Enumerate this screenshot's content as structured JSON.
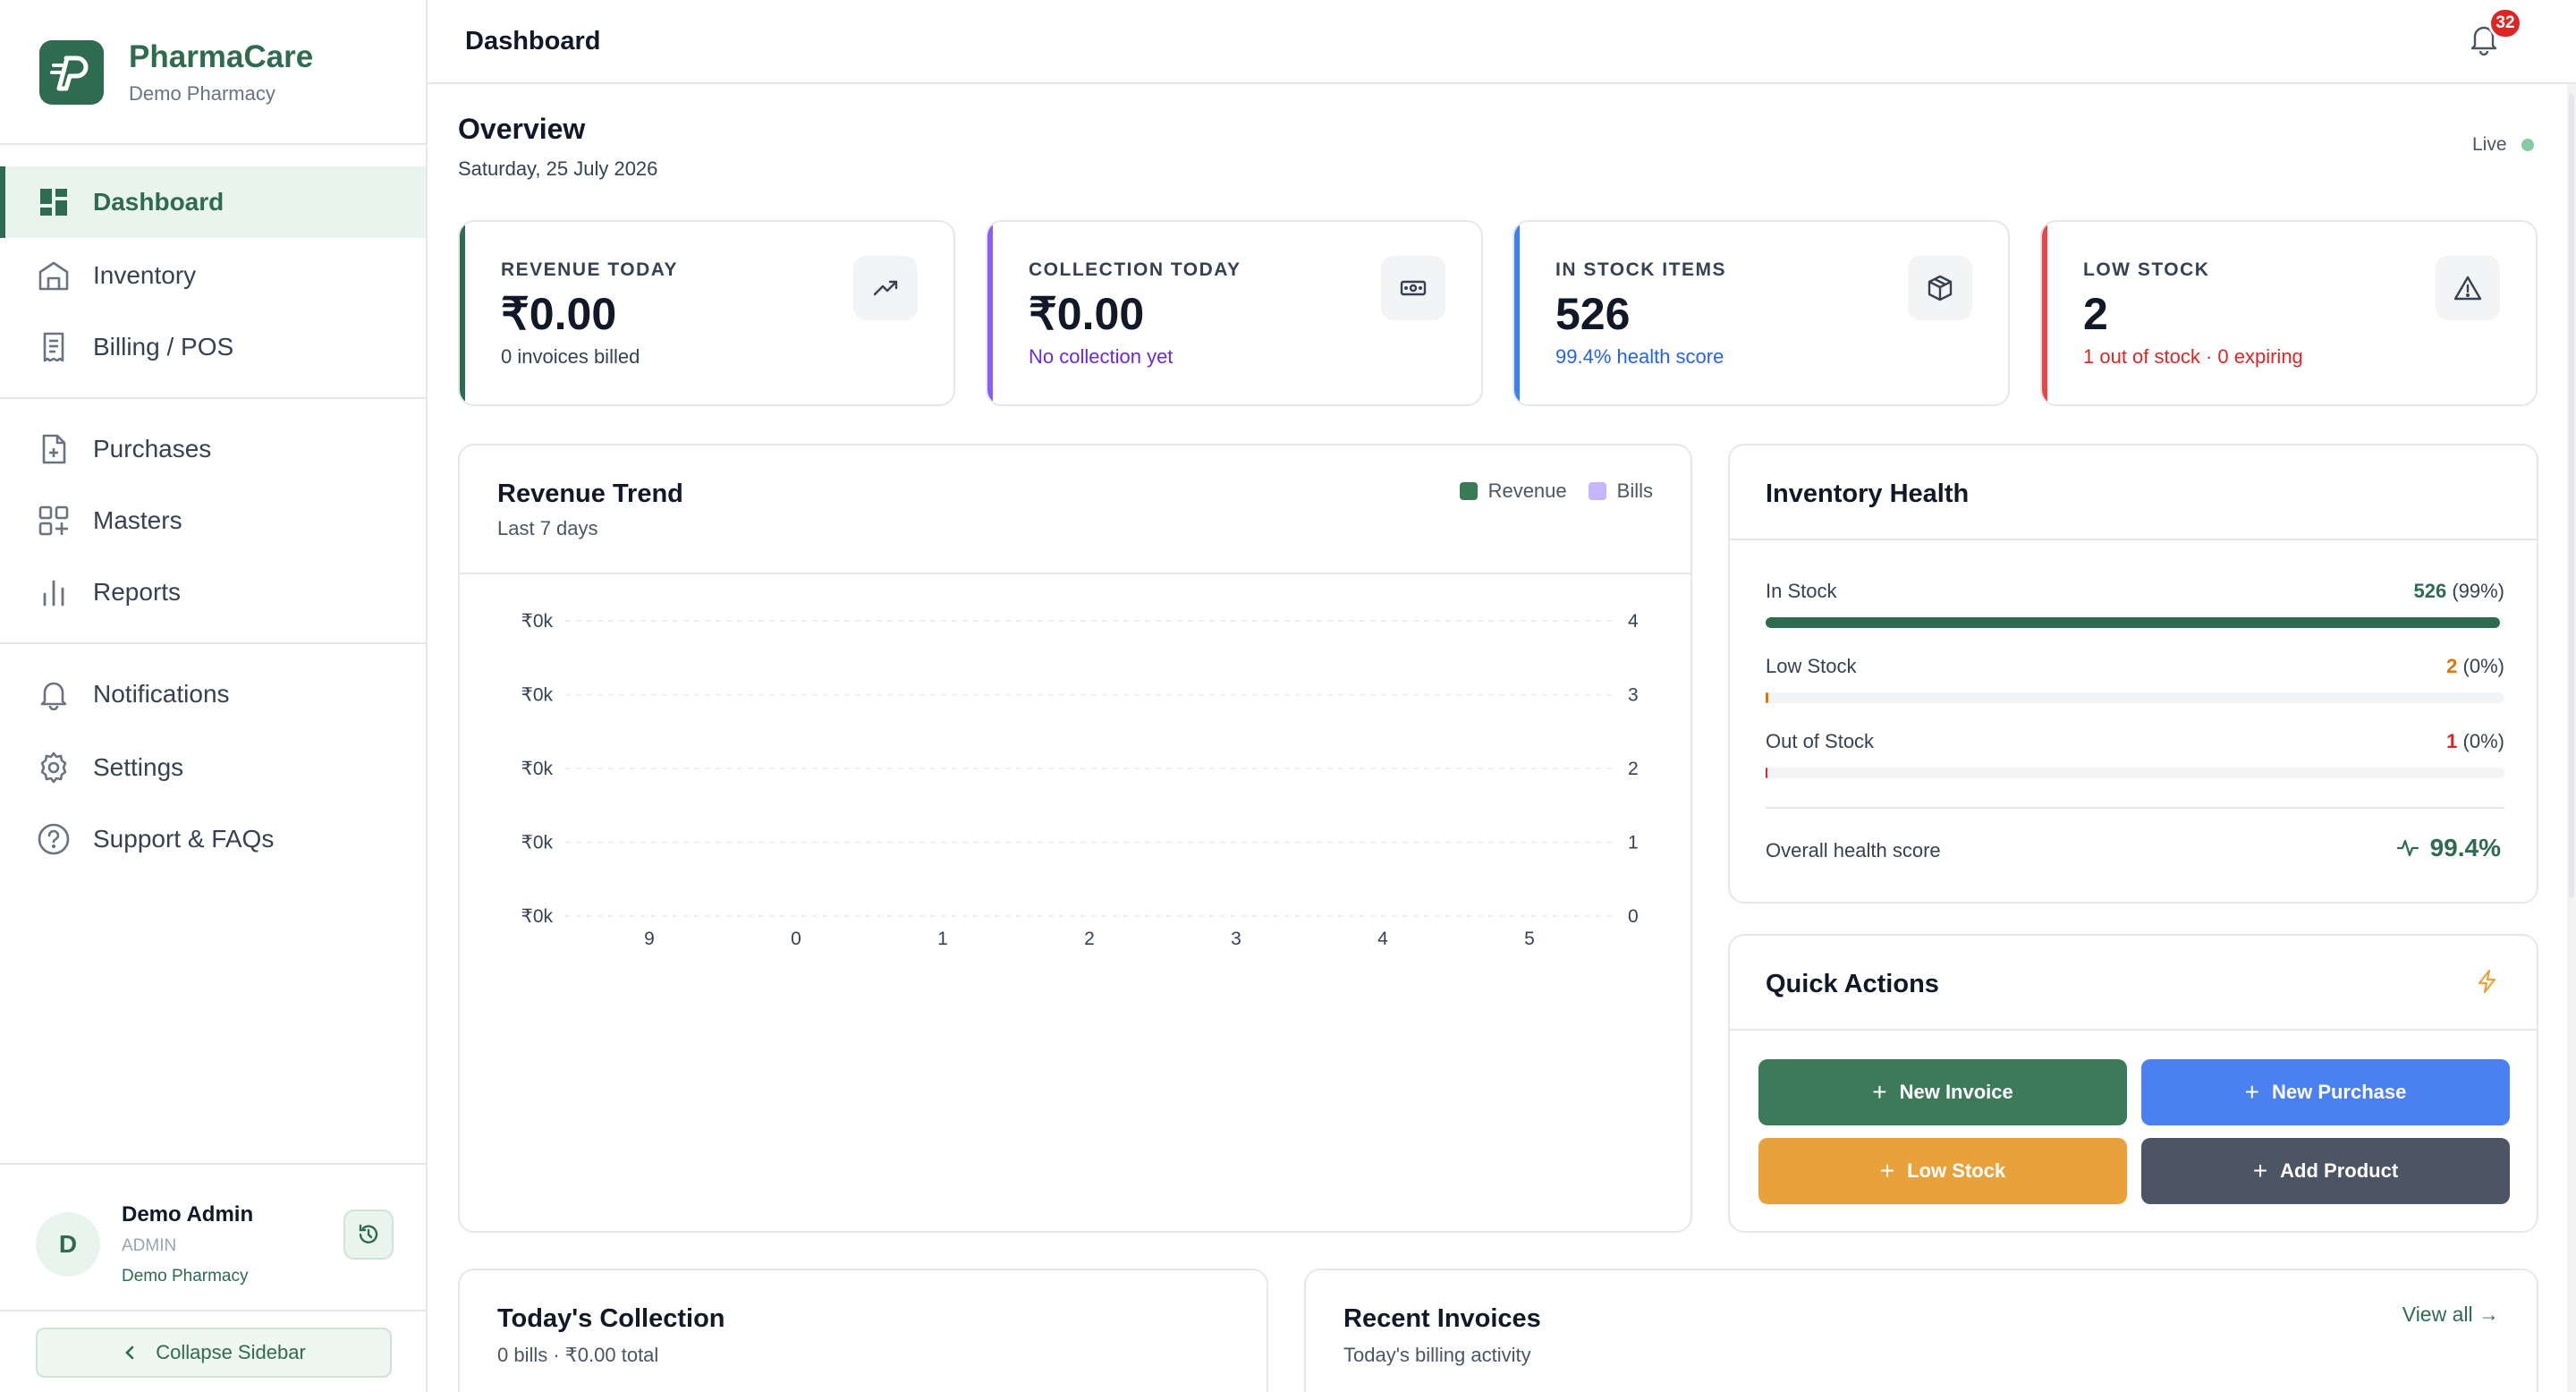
{
  "brand": {
    "name_part1": "Pharma",
    "name_part2": "Care",
    "subtitle": "Demo Pharmacy"
  },
  "nav": {
    "dashboard": "Dashboard",
    "inventory": "Inventory",
    "billing": "Billing / POS",
    "purchases": "Purchases",
    "masters": "Masters",
    "reports": "Reports",
    "notifications": "Notifications",
    "settings": "Settings",
    "support": "Support & FAQs"
  },
  "user": {
    "initial": "D",
    "name": "Demo Admin",
    "role": "ADMIN",
    "org": "Demo Pharmacy"
  },
  "collapse_label": "Collapse Sidebar",
  "header": {
    "title": "Dashboard",
    "notification_count": "32"
  },
  "overview": {
    "title": "Overview",
    "date": "Saturday, 25 July 2026",
    "live_label": "Live"
  },
  "stats": [
    {
      "label": "REVENUE TODAY",
      "value": "₹0.00",
      "sub": "0 invoices billed",
      "accent": "#2e6b50",
      "sub_color": "#374151",
      "icon": "trending-up-icon"
    },
    {
      "label": "COLLECTION TODAY",
      "value": "₹0.00",
      "sub": "No collection yet",
      "accent": "#8b5cf6",
      "sub_color": "#6d28d9",
      "icon": "cash-icon"
    },
    {
      "label": "IN STOCK ITEMS",
      "value": "526",
      "sub": "99.4% health score",
      "accent": "#3b82f6",
      "sub_color": "#2563eb",
      "icon": "box-icon"
    },
    {
      "label": "LOW STOCK",
      "value": "2",
      "sub": "1 out of stock · 0 expiring",
      "accent": "#ef4444",
      "sub_color": "#dc2626",
      "icon": "warning-icon"
    }
  ],
  "revenue_trend": {
    "title": "Revenue Trend",
    "subtitle": "Last 7 days",
    "legend": {
      "revenue": "Revenue",
      "bills": "Bills"
    },
    "colors": {
      "revenue": "#3b7a57",
      "bills": "#c4b5fd"
    }
  },
  "chart_data": {
    "type": "line",
    "x": [
      "9",
      "0",
      "1",
      "2",
      "3",
      "4",
      "5"
    ],
    "series": [
      {
        "name": "Revenue",
        "values": [
          0,
          0,
          0,
          0,
          0,
          0,
          0
        ]
      },
      {
        "name": "Bills",
        "values": [
          0,
          0,
          0,
          0,
          0,
          0,
          0
        ]
      }
    ],
    "y_left_ticks": [
      "₹0k",
      "₹0k",
      "₹0k",
      "₹0k",
      "₹0k"
    ],
    "y_right_ticks": [
      "4",
      "3",
      "2",
      "1",
      "0"
    ],
    "ylim_right": [
      0,
      4
    ],
    "grid": true,
    "legend_position": "top-right"
  },
  "inventory_health": {
    "title": "Inventory Health",
    "rows": [
      {
        "label": "In Stock",
        "count": "526",
        "pct": "(99%)",
        "fraction": 0.994,
        "color": "#2e6b50"
      },
      {
        "label": "Low Stock",
        "count": "2",
        "pct": "(0%)",
        "fraction": 0.004,
        "color": "#d97706"
      },
      {
        "label": "Out of Stock",
        "count": "1",
        "pct": "(0%)",
        "fraction": 0.002,
        "color": "#dc2626"
      }
    ],
    "overall_label": "Overall health score",
    "overall_value": "99.4%"
  },
  "quick_actions": {
    "title": "Quick Actions",
    "new_invoice": "New Invoice",
    "new_purchase": "New Purchase",
    "low_stock": "Low Stock",
    "add_product": "Add Product",
    "colors": {
      "new_invoice": "#3d7a5a",
      "new_purchase": "#4a80f0",
      "low_stock": "#e9a23b",
      "add_product": "#4b5563"
    }
  },
  "todays_collection": {
    "title": "Today's Collection",
    "subtitle": "0 bills · ₹0.00 total"
  },
  "recent_invoices": {
    "title": "Recent Invoices",
    "subtitle": "Today's billing activity",
    "view_all": "View all →"
  }
}
